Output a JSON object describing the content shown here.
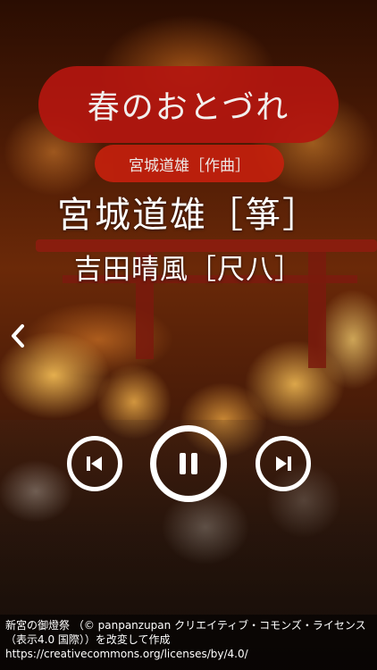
{
  "player": {
    "title": "春のおとづれ",
    "composer": "宮城道雄［作曲］",
    "performer_1": "宮城道雄［箏］",
    "performer_2": "吉田晴風［尺八］"
  },
  "controls": {
    "back_icon": "chevron-left-icon",
    "prev_icon": "skip-previous-icon",
    "play_icon": "pause-icon",
    "next_icon": "skip-next-icon"
  },
  "credit": {
    "text": "新宮の御燈祭 （© panpanzupan クリエイティブ・コモンズ・ライセンス（表示4.0 国際））を改変して作成 https://creativecommons.org/licenses/by/4.0/"
  },
  "colors": {
    "accent": "#b3160f",
    "composer_pill": "#c6200d"
  }
}
